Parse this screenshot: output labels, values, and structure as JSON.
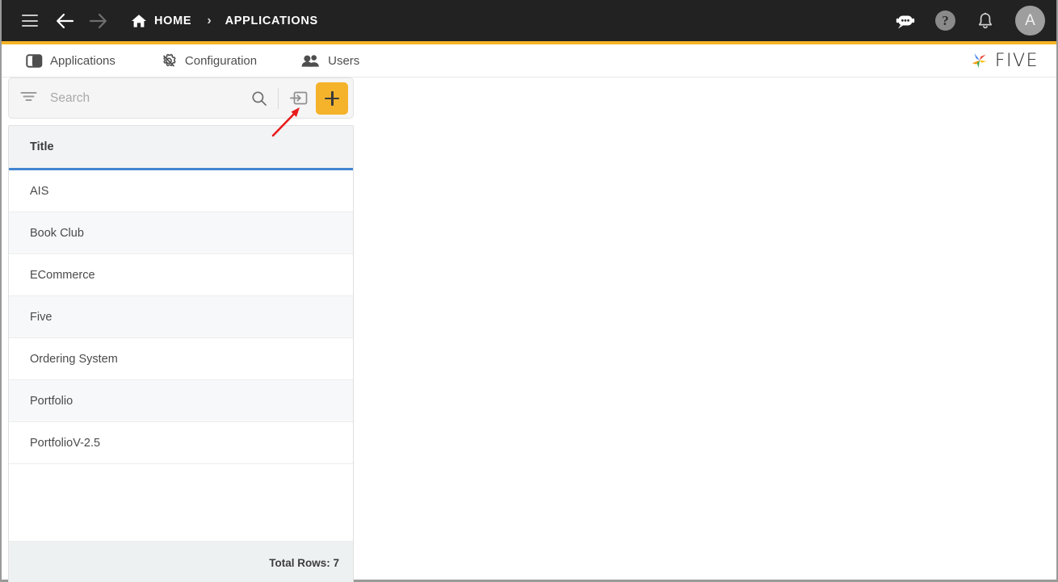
{
  "topbar": {
    "menu_icon": "hamburger-menu-icon",
    "back_icon": "arrow-left-icon",
    "forward_icon": "arrow-right-icon",
    "home_icon": "home-icon",
    "home_label": "HOME",
    "separator": "›",
    "current_label": "APPLICATIONS",
    "bot_icon": "chat-bot-icon",
    "help_label": "?",
    "help_icon": "help-circle-icon",
    "bell_icon": "notification-bell-icon",
    "avatar_label": "A",
    "accent_color": "#f5b324",
    "background_color": "#222222"
  },
  "tabs": [
    {
      "label": "Applications",
      "icon": "applications-panel-icon"
    },
    {
      "label": "Configuration",
      "icon": "gear-settings-icon"
    },
    {
      "label": "Users",
      "icon": "users-people-icon"
    }
  ],
  "logo": {
    "text": "FIVE",
    "mark_icon": "five-pinwheel-logo-icon",
    "colors": [
      "#4285f4",
      "#ea4335",
      "#fbbc05",
      "#34a853"
    ]
  },
  "toolbar": {
    "filter_icon": "filter-funnel-icon",
    "search_placeholder": "Search",
    "search_value": "",
    "search_icon": "magnifier-search-icon",
    "import_icon": "import-arrow-into-box-icon",
    "add_label": "+",
    "add_icon": "plus-icon",
    "add_button_color": "#f5b32c"
  },
  "grid": {
    "columns": [
      "Title"
    ],
    "header_underline_color": "#4285d0",
    "rows": [
      {
        "title": "AIS"
      },
      {
        "title": "Book Club"
      },
      {
        "title": "ECommerce"
      },
      {
        "title": "Five"
      },
      {
        "title": "Ordering System"
      },
      {
        "title": "Portfolio"
      },
      {
        "title": "PortfolioV-2.5"
      }
    ],
    "footer_label": "Total Rows: 7"
  },
  "annotation": {
    "arrow_color": "#e81c1c",
    "points_to": "import-arrow-into-box-icon"
  }
}
